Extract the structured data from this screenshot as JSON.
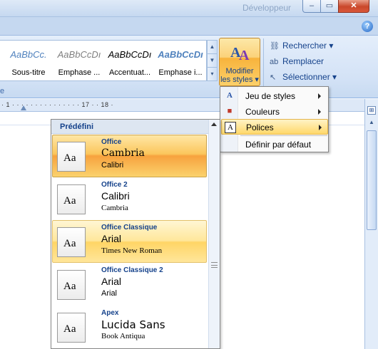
{
  "window": {
    "title": "Développeur",
    "buttons": {
      "minimize": "–",
      "maximize": "▭",
      "close": "✕"
    }
  },
  "help_label": "?",
  "quick_styles": [
    {
      "preview": "AaBbCc.",
      "label": "Sous-titre"
    },
    {
      "preview": "AaBbCcDı",
      "label": "Emphase ..."
    },
    {
      "preview": "AaBbCcDı",
      "label": "Accentuat..."
    },
    {
      "preview": "AaBbCcDı",
      "label": "Emphase i..."
    }
  ],
  "gallery_scroll": {
    "up": "▲",
    "down": "▼",
    "more": "▾"
  },
  "modify_styles": {
    "label": "Modifier\nles styles ▾"
  },
  "editing": {
    "find": "Rechercher ▾",
    "replace": "Remplacer",
    "select": "Sélectionner ▾"
  },
  "ribbon_group_label": "e",
  "ruler": {
    "text": "· 1 · · · · · · · · · · · · · · · 17 · · 18 ·"
  },
  "scroll": {
    "up": "▲",
    "ruler_toggle": "⊞"
  },
  "menu": {
    "items": [
      {
        "icon": "A",
        "label": "Jeu de styles",
        "submenu": true
      },
      {
        "icon": "■",
        "label": "Couleurs",
        "submenu": true
      },
      {
        "icon": "A",
        "label": "Polices",
        "submenu": true
      },
      {
        "icon": "",
        "label": "Définir par défaut",
        "submenu": false
      }
    ]
  },
  "fonts_panel": {
    "header": "Prédéfini",
    "aa_glyph": "Aa",
    "items": [
      {
        "name": "Office",
        "heading": "Cambria",
        "body": "Calibri",
        "state": "selected"
      },
      {
        "name": "Office 2",
        "heading": "Calibri",
        "body": "Cambria",
        "state": "normal"
      },
      {
        "name": "Office Classique",
        "heading": "Arial",
        "body": "Times New Roman",
        "state": "hover"
      },
      {
        "name": "Office Classique 2",
        "heading": "Arial",
        "body": "Arial",
        "state": "normal"
      },
      {
        "name": "Apex",
        "heading": "Lucida Sans",
        "body": "Book Antiqua",
        "state": "normal"
      }
    ]
  },
  "colors": {
    "ribbon_text": "#15428b",
    "highlight_selected": "#f7a23e",
    "highlight_hover": "#ffd566"
  }
}
